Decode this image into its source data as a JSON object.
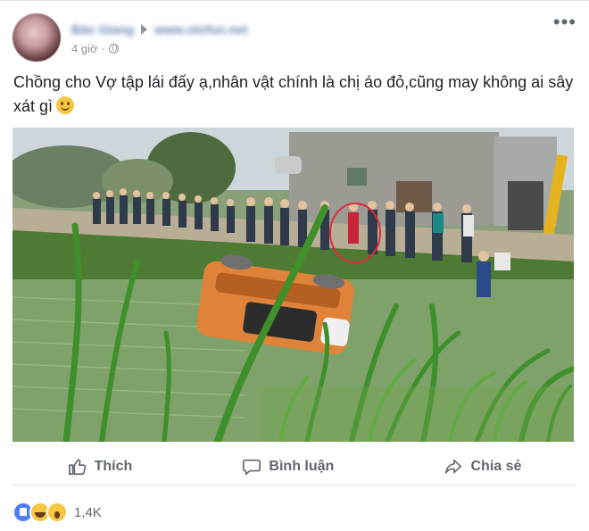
{
  "post": {
    "author_blurred": "Bảo Giang",
    "page_blurred": "www.otofun.net",
    "time": "4 giờ",
    "privacy_icon": "globe-icon",
    "more_icon": "more-options-icon",
    "caption": "Chồng cho Vợ tập lái đấy ạ,nhân vật chính là chị áo đỏ,cũng may không ai sây xát gì",
    "caption_emoji": "smile-icon"
  },
  "actions": {
    "like": "Thích",
    "comment": "Bình luận",
    "share": "Chia sẻ"
  },
  "reactions": {
    "count": "1,4K",
    "types": [
      "like",
      "haha",
      "wow"
    ]
  },
  "colors": {
    "accent": "#365899",
    "secondary_text": "#606770",
    "like_blue": "#4f7df3",
    "highlight_circle": "#e0283a"
  }
}
